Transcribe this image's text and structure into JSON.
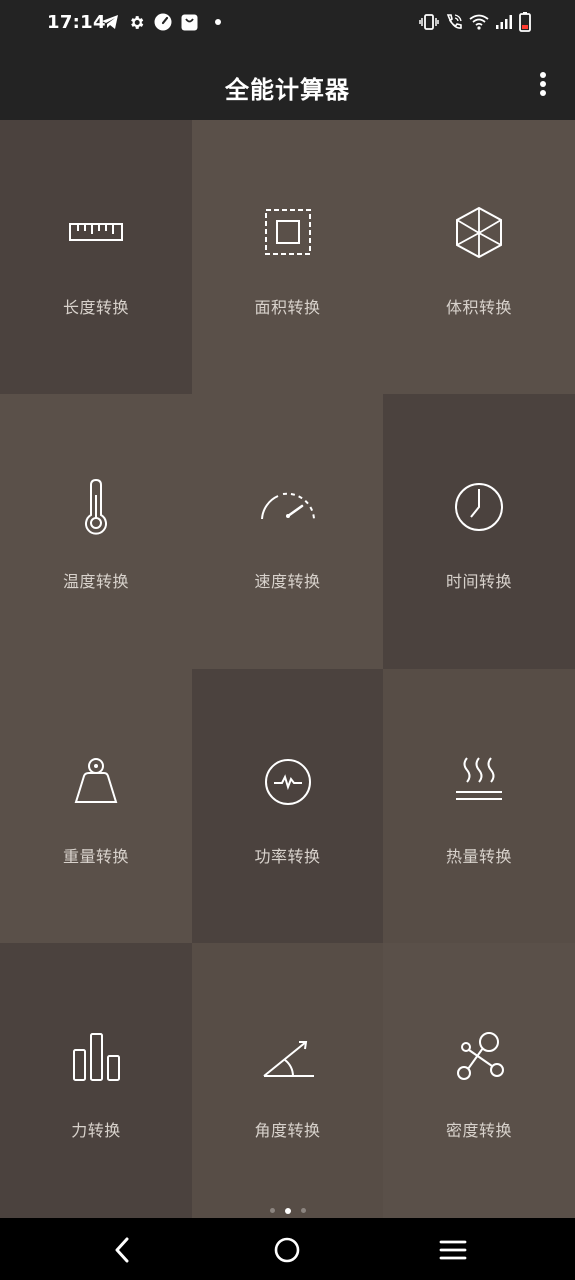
{
  "status_bar": {
    "time": "17:14",
    "left_icons": [
      "telegram-icon",
      "gear-icon",
      "speedometer-icon",
      "shopping-bag-icon",
      "dot-icon"
    ],
    "right_icons": [
      "vibrate-icon",
      "wifi-calling-icon",
      "wifi-icon",
      "signal-icon",
      "battery-low-icon"
    ]
  },
  "app_bar": {
    "title": "全能计算器",
    "menu_icon": "more-vertical-icon"
  },
  "tiles": [
    {
      "label": "长度转换",
      "icon": "ruler-icon"
    },
    {
      "label": "面积转换",
      "icon": "area-square-icon"
    },
    {
      "label": "体积转换",
      "icon": "cube-icon"
    },
    {
      "label": "温度转换",
      "icon": "thermometer-icon"
    },
    {
      "label": "速度转换",
      "icon": "speedometer-icon"
    },
    {
      "label": "时间转换",
      "icon": "clock-icon"
    },
    {
      "label": "重量转换",
      "icon": "weight-icon"
    },
    {
      "label": "功率转换",
      "icon": "power-pulse-icon"
    },
    {
      "label": "热量转换",
      "icon": "heat-icon"
    },
    {
      "label": "力转换",
      "icon": "bar-chart-icon"
    },
    {
      "label": "角度转换",
      "icon": "angle-icon"
    },
    {
      "label": "密度转换",
      "icon": "molecule-icon"
    }
  ],
  "pager": {
    "count": 3,
    "active": 2
  },
  "nav_bar": {
    "icons": [
      "back-icon",
      "home-icon",
      "recents-icon"
    ]
  },
  "colors": {
    "dark": "#4b423e",
    "mid": "#574d46",
    "light": "#5a5049",
    "bar": "#232323"
  }
}
